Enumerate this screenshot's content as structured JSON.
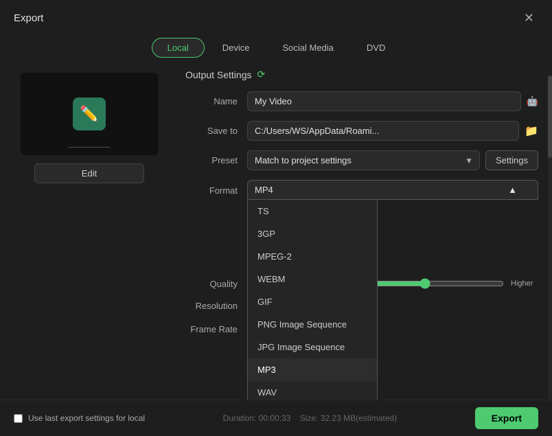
{
  "window": {
    "title": "Export",
    "close_label": "✕"
  },
  "tabs": [
    {
      "id": "local",
      "label": "Local",
      "active": true
    },
    {
      "id": "device",
      "label": "Device",
      "active": false
    },
    {
      "id": "social-media",
      "label": "Social Media",
      "active": false
    },
    {
      "id": "dvd",
      "label": "DVD",
      "active": false
    }
  ],
  "preview": {
    "edit_label": "Edit"
  },
  "output_settings": {
    "header": "Output Settings",
    "fields": {
      "name_label": "Name",
      "name_value": "My Video",
      "save_to_label": "Save to",
      "save_to_value": "C:/Users/WS/AppData/Roami...",
      "preset_label": "Preset",
      "preset_value": "Match to project settings",
      "format_label": "Format",
      "format_value": "MP4",
      "quality_label": "Quality",
      "quality_right": "Higher",
      "resolution_label": "Resolution",
      "frame_rate_label": "Frame Rate",
      "settings_label": "Settings"
    }
  },
  "format_options": [
    {
      "id": "ts",
      "label": "TS"
    },
    {
      "id": "3gp",
      "label": "3GP"
    },
    {
      "id": "mpeg2",
      "label": "MPEG-2"
    },
    {
      "id": "webm",
      "label": "WEBM"
    },
    {
      "id": "gif",
      "label": "GIF"
    },
    {
      "id": "png-seq",
      "label": "PNG Image Sequence"
    },
    {
      "id": "jpg-seq",
      "label": "JPG Image Sequence"
    },
    {
      "id": "mp3",
      "label": "MP3",
      "selected": true
    },
    {
      "id": "wav",
      "label": "WAV"
    }
  ],
  "bottom": {
    "checkbox_label": "Use last export settings for local",
    "duration_label": "Duration: 00:00:33",
    "size_label": "Size: 32.23 MB(estimated)",
    "export_label": "Export"
  }
}
